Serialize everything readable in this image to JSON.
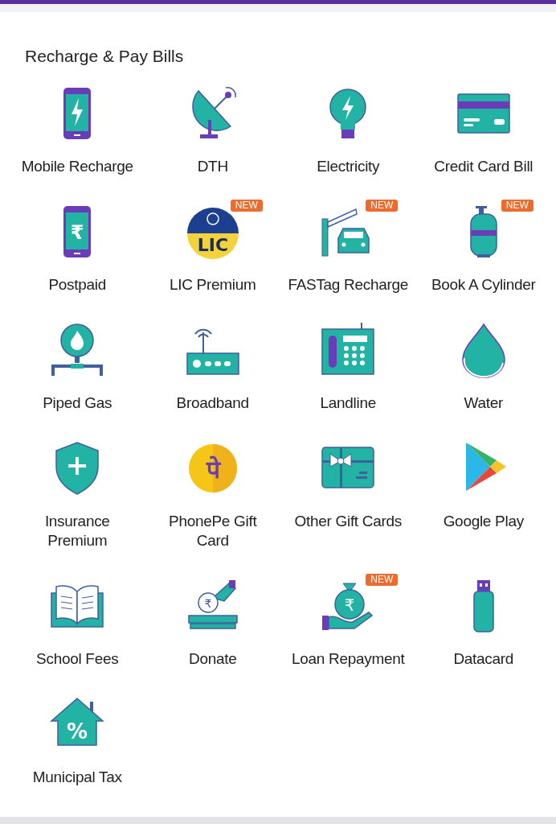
{
  "section": {
    "title": "Recharge & Pay Bills"
  },
  "items": [
    {
      "label": "Mobile Recharge",
      "kind": "mobile"
    },
    {
      "label": "DTH",
      "kind": "dish"
    },
    {
      "label": "Electricity",
      "kind": "bulb"
    },
    {
      "label": "Credit Card Bill",
      "kind": "card"
    },
    {
      "label": "Postpaid",
      "kind": "postpaid",
      "glyph": "₹"
    },
    {
      "label": "LIC Premium",
      "kind": "lic",
      "glyph": "LIC",
      "badge": "NEW"
    },
    {
      "label": "FASTag Recharge",
      "kind": "fastag",
      "badge": "NEW"
    },
    {
      "label": "Book A Cylinder",
      "kind": "cylinder",
      "badge": "NEW"
    },
    {
      "label": "Piped Gas",
      "kind": "gas"
    },
    {
      "label": "Broadband",
      "kind": "router"
    },
    {
      "label": "Landline",
      "kind": "phone"
    },
    {
      "label": "Water",
      "kind": "drop"
    },
    {
      "label": "Insurance Premium",
      "kind": "shield"
    },
    {
      "label": "PhonePe Gift Card",
      "kind": "phonepe",
      "glyph": "पे"
    },
    {
      "label": "Other Gift Cards",
      "kind": "giftcard"
    },
    {
      "label": "Google Play",
      "kind": "play"
    },
    {
      "label": "School Fees",
      "kind": "book"
    },
    {
      "label": "Donate",
      "kind": "donate",
      "glyph": "₹"
    },
    {
      "label": "Loan Repayment",
      "kind": "loan",
      "glyph": "₹",
      "badge": "NEW"
    },
    {
      "label": "Datacard",
      "kind": "usb"
    },
    {
      "label": "Municipal Tax",
      "kind": "house",
      "glyph": "%"
    }
  ]
}
